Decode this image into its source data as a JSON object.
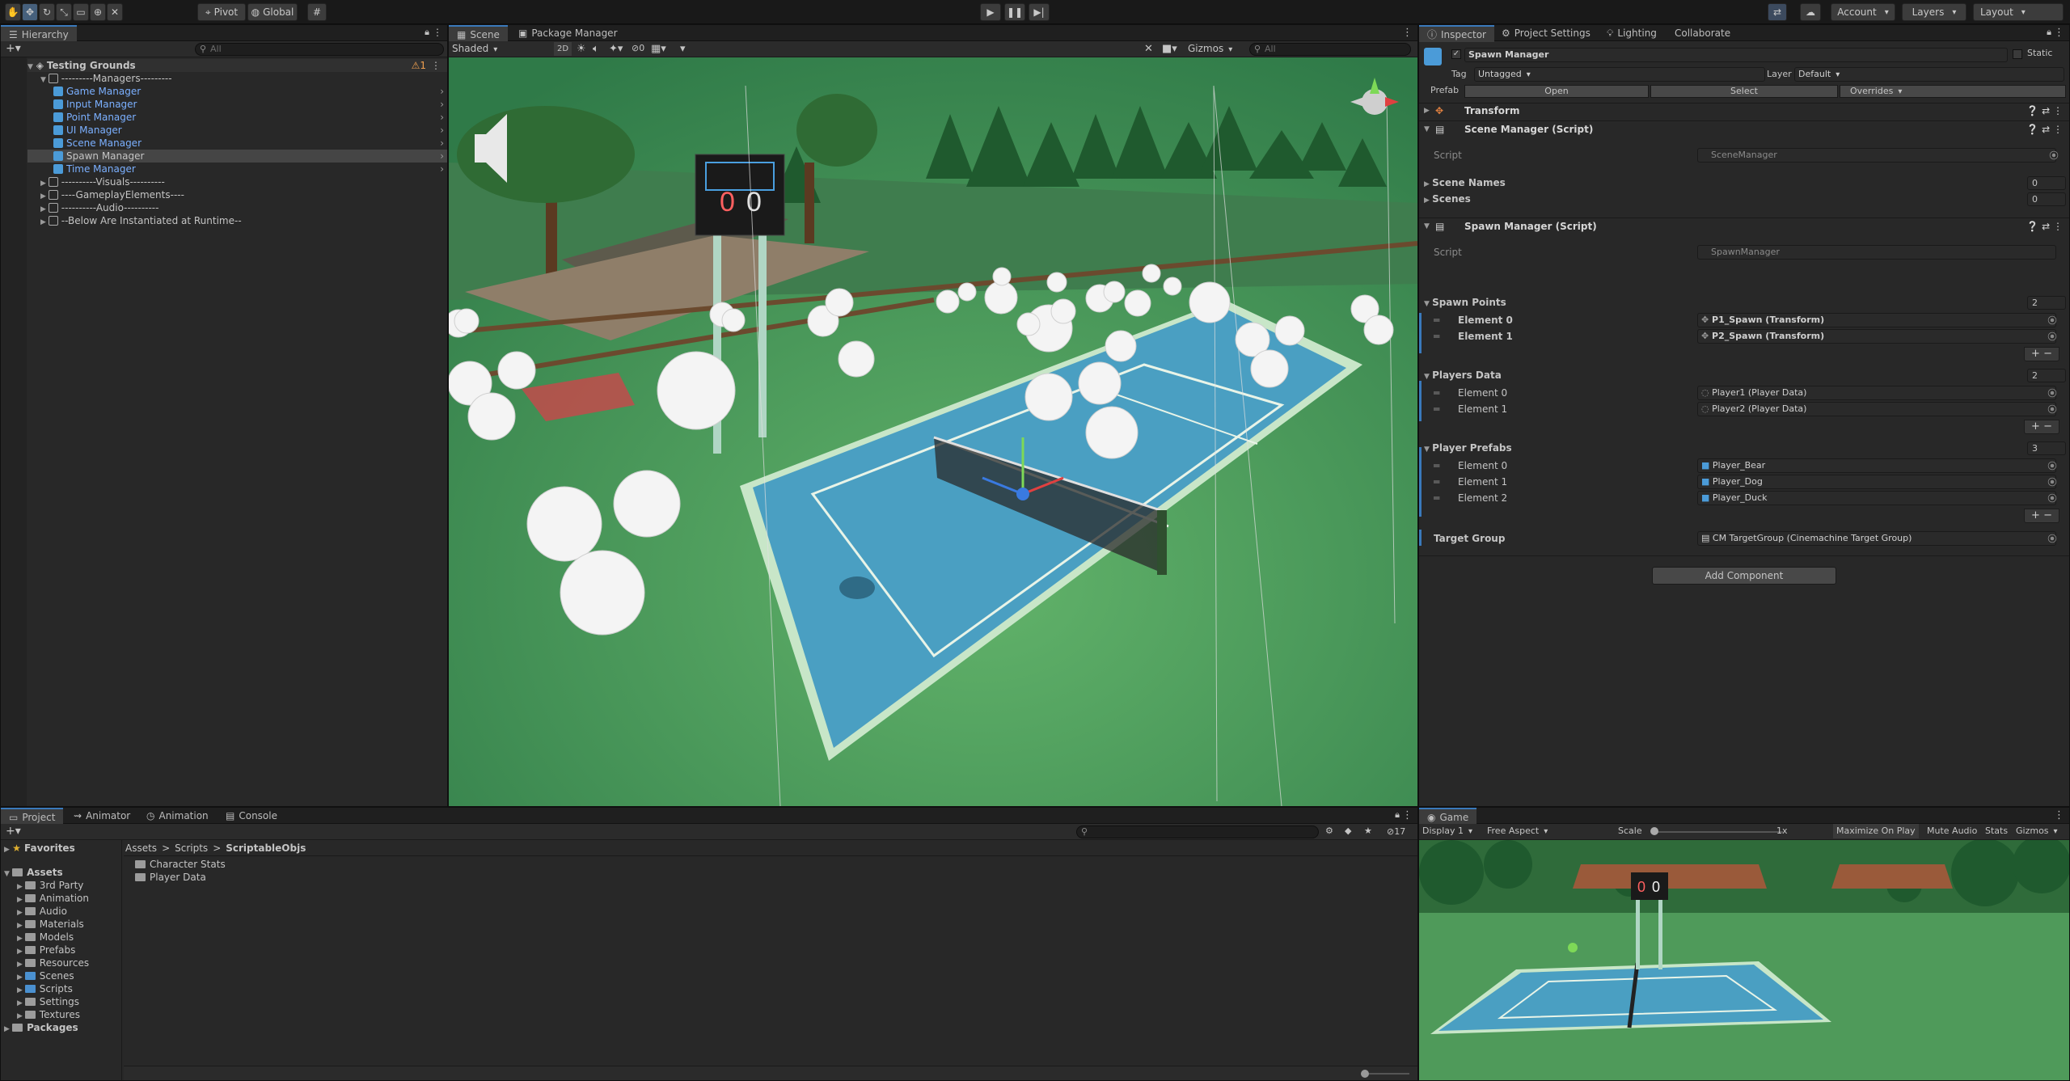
{
  "toolbar": {
    "pivot": "Pivot",
    "global": "Global",
    "account": "Account",
    "layers": "Layers",
    "layout": "Layout"
  },
  "hierarchy": {
    "tab": "Hierarchy",
    "search_placeholder": "All",
    "scene": "Testing Grounds",
    "scene_badge": "1",
    "items": [
      {
        "label": "---------Managers---------",
        "type": "go",
        "depth": 1,
        "expanded": true
      },
      {
        "label": "Game Manager",
        "type": "prefab",
        "depth": 2
      },
      {
        "label": "Input Manager",
        "type": "prefab",
        "depth": 2
      },
      {
        "label": "Point Manager",
        "type": "prefab",
        "depth": 2
      },
      {
        "label": "UI Manager",
        "type": "prefab",
        "depth": 2
      },
      {
        "label": "Scene Manager",
        "type": "prefab",
        "depth": 2
      },
      {
        "label": "Spawn Manager",
        "type": "prefab",
        "depth": 2,
        "selected": true
      },
      {
        "label": "Time Manager",
        "type": "prefab",
        "depth": 2
      },
      {
        "label": "----------Visuals----------",
        "type": "go",
        "depth": 1
      },
      {
        "label": "----GameplayElements----",
        "type": "go",
        "depth": 1
      },
      {
        "label": "----------Audio----------",
        "type": "go",
        "depth": 1
      },
      {
        "label": "--Below Are Instantiated at Runtime--",
        "type": "go",
        "depth": 1
      }
    ]
  },
  "scene_view": {
    "tabs": [
      "Scene",
      "Package Manager"
    ],
    "shading": "Shaded",
    "mode_2d": "2D",
    "hidden_count": "0",
    "gizmos": "Gizmos",
    "search_placeholder": "All",
    "scoreboard_left": "0",
    "scoreboard_right": "0"
  },
  "inspector": {
    "tabs": [
      "Inspector",
      "Project Settings",
      "Lighting",
      "Collaborate"
    ],
    "object_name": "Spawn Manager",
    "static_label": "Static",
    "tag_label": "Tag",
    "tag_value": "Untagged",
    "layer_label": "Layer",
    "layer_value": "Default",
    "prefab_label": "Prefab",
    "open": "Open",
    "select": "Select",
    "overrides": "Overrides",
    "transform": "Transform",
    "scene_manager_script": "Scene Manager (Script)",
    "script_label": "Script",
    "scene_manager_value": "SceneManager",
    "scene_names": "Scene Names",
    "scene_names_count": "0",
    "scenes": "Scenes",
    "scenes_count": "0",
    "spawn_manager_script": "Spawn Manager (Script)",
    "spawn_manager_value": "SpawnManager",
    "spawn_points": "Spawn Points",
    "spawn_points_count": "2",
    "spawn_points_items": [
      {
        "label": "Element 0",
        "value": "P1_Spawn (Transform)"
      },
      {
        "label": "Element 1",
        "value": "P2_Spawn (Transform)"
      }
    ],
    "players_data": "Players Data",
    "players_data_count": "2",
    "players_data_items": [
      {
        "label": "Element 0",
        "value": "Player1 (Player Data)"
      },
      {
        "label": "Element 1",
        "value": "Player2 (Player Data)"
      }
    ],
    "player_prefabs": "Player Prefabs",
    "player_prefabs_count": "3",
    "player_prefabs_items": [
      {
        "label": "Element 0",
        "value": "Player_Bear"
      },
      {
        "label": "Element 1",
        "value": "Player_Dog"
      },
      {
        "label": "Element 2",
        "value": "Player_Duck"
      }
    ],
    "target_group": "Target Group",
    "target_group_value": "CM TargetGroup (Cinemachine Target Group)",
    "add_component": "Add Component"
  },
  "project": {
    "tabs": [
      "Project",
      "Animator",
      "Animation",
      "Console"
    ],
    "hidden_count": "17",
    "favorites": "Favorites",
    "assets": "Assets",
    "folders": [
      "3rd Party",
      "Animation",
      "Audio",
      "Materials",
      "Models",
      "Prefabs",
      "Resources",
      "Scenes",
      "Scripts",
      "Settings",
      "Textures"
    ],
    "packages": "Packages",
    "breadcrumb": [
      "Assets",
      "Scripts",
      "ScriptableObjs"
    ],
    "files": [
      "Character Stats",
      "Player Data"
    ]
  },
  "game": {
    "tab": "Game",
    "display": "Display 1",
    "aspect": "Free Aspect",
    "scale_label": "Scale",
    "scale_value": "1x",
    "maximize": "Maximize On Play",
    "mute": "Mute Audio",
    "stats": "Stats",
    "gizmos": "Gizmos",
    "score_left": "0",
    "score_right": "0"
  }
}
